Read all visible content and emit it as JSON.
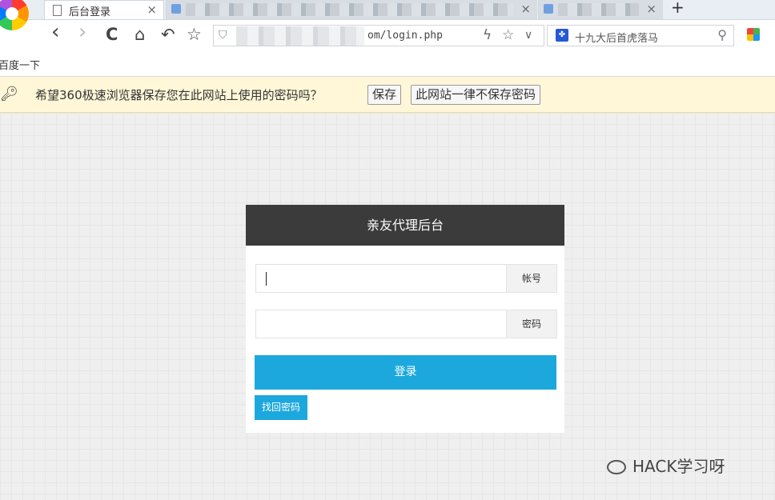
{
  "browser": {
    "active_tab": {
      "title": "后台登录",
      "close": "×"
    },
    "inactive_tabs": [
      {
        "close": "×"
      },
      {
        "close": "×"
      }
    ],
    "new_tab": "+",
    "nav": {
      "back": "‹",
      "forward": "›",
      "reload": "C",
      "home": "⌂",
      "undo": "↶",
      "star": "☆"
    },
    "url": "om/login.php",
    "search_text": "十九大后首虎落马",
    "bookmark": "百度一下"
  },
  "infobar": {
    "message": "希望360极速浏览器保存您在此网站上使用的密码吗？",
    "save_label": "保存",
    "never_label": "此网站一律不保存密码"
  },
  "login": {
    "title": "亲友代理后台",
    "account_label": "帐号",
    "password_label": "密码",
    "submit_label": "登录",
    "forgot_label": "找回密码"
  },
  "watermark": "HACK学习呀"
}
